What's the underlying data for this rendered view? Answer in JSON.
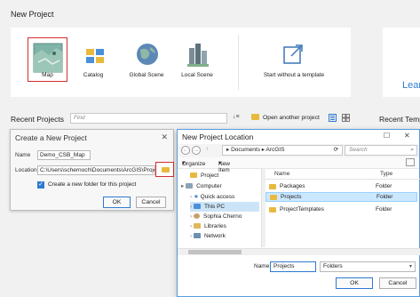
{
  "page": {
    "title": "New Project"
  },
  "templates": [
    {
      "label": "Map",
      "icon": "map-template-icon",
      "selected": true
    },
    {
      "label": "Catalog",
      "icon": "catalog-template-icon"
    },
    {
      "label": "Global Scene",
      "icon": "globe-template-icon"
    },
    {
      "label": "Local Scene",
      "icon": "local-scene-template-icon"
    },
    {
      "label": "Start without a template",
      "icon": "start-without-template-icon"
    }
  ],
  "learn_card": {
    "label": "Lear"
  },
  "recent": {
    "title": "Recent Projects",
    "find_placeholder": "Find",
    "open_another": "Open another project",
    "templates_title": "Recent Temp"
  },
  "create_dialog": {
    "title": "Create a New Project",
    "name_label": "Name",
    "name_value": "Demo_CSB_Map",
    "location_label": "Location",
    "location_value": "C:\\Users\\schernoch\\Documents\\ArcGIS\\Proje",
    "checkbox_label": "Create a new folder for this project",
    "ok_label": "OK",
    "cancel_label": "Cancel"
  },
  "location_dialog": {
    "title": "New Project Location",
    "breadcrumb": [
      "Documents",
      "ArcGIS"
    ],
    "search_placeholder": "Search",
    "organize_label": "Organize",
    "new_item_label": "New Item",
    "tree": [
      {
        "label": "Project",
        "icon": "project-icon"
      },
      {
        "label": "Computer",
        "icon": "computer-icon"
      },
      {
        "label": "Quick access",
        "icon": "star-icon"
      },
      {
        "label": "This PC",
        "icon": "pc-icon",
        "selected": true
      },
      {
        "label": "Sophia Cherno",
        "icon": "user-icon"
      },
      {
        "label": "Libraries",
        "icon": "library-icon"
      },
      {
        "label": "Network",
        "icon": "network-icon"
      }
    ],
    "columns": {
      "name": "Name",
      "type": "Type"
    },
    "rows": [
      {
        "name": "Packages",
        "type": "Folder"
      },
      {
        "name": "Projects",
        "type": "Folder",
        "selected": true
      },
      {
        "name": "ProjectTemplates",
        "type": "Folder"
      }
    ],
    "name_label": "Name",
    "name_value": "Projects",
    "type_value": "Folders",
    "ok_label": "OK",
    "cancel_label": "Cancel"
  },
  "colors": {
    "accent": "#2f7ad0",
    "highlight_red": "#d32f2f",
    "folder": "#e8b93f"
  }
}
